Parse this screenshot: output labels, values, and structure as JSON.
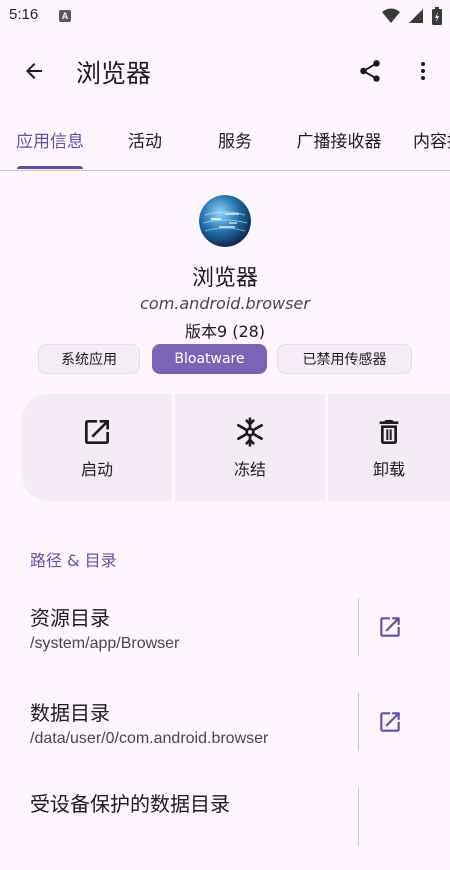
{
  "status_bar": {
    "time": "5:16",
    "notif_letter": "A"
  },
  "app_bar": {
    "title": "浏览器"
  },
  "tabs": [
    {
      "label": "应用信息",
      "active": true
    },
    {
      "label": "活动"
    },
    {
      "label": "服务"
    },
    {
      "label": "广播接收器"
    },
    {
      "label": "内容提"
    }
  ],
  "app": {
    "name": "浏览器",
    "package": "com.android.browser",
    "version": "版本9 (28)"
  },
  "tags": [
    {
      "label": "系统应用"
    },
    {
      "label": "Bloatware"
    },
    {
      "label": "已禁用传感器"
    }
  ],
  "actions": [
    {
      "label": "启动",
      "icon": "open-external-icon"
    },
    {
      "label": "冻结",
      "icon": "snowflake-icon"
    },
    {
      "label": "卸载",
      "icon": "trash-icon"
    }
  ],
  "paths_section": {
    "title": "路径 & 目录",
    "rows": [
      {
        "title": "资源目录",
        "subtitle": "/system/app/Browser"
      },
      {
        "title": "数据目录",
        "subtitle": "/data/user/0/com.android.browser"
      },
      {
        "title": "受设备保护的数据目录",
        "subtitle": ""
      }
    ]
  },
  "colors": {
    "accent": "#6750a4",
    "background": "#fdf7fd",
    "card": "#f2ecf4",
    "chip_filled": "#7b62b5"
  }
}
